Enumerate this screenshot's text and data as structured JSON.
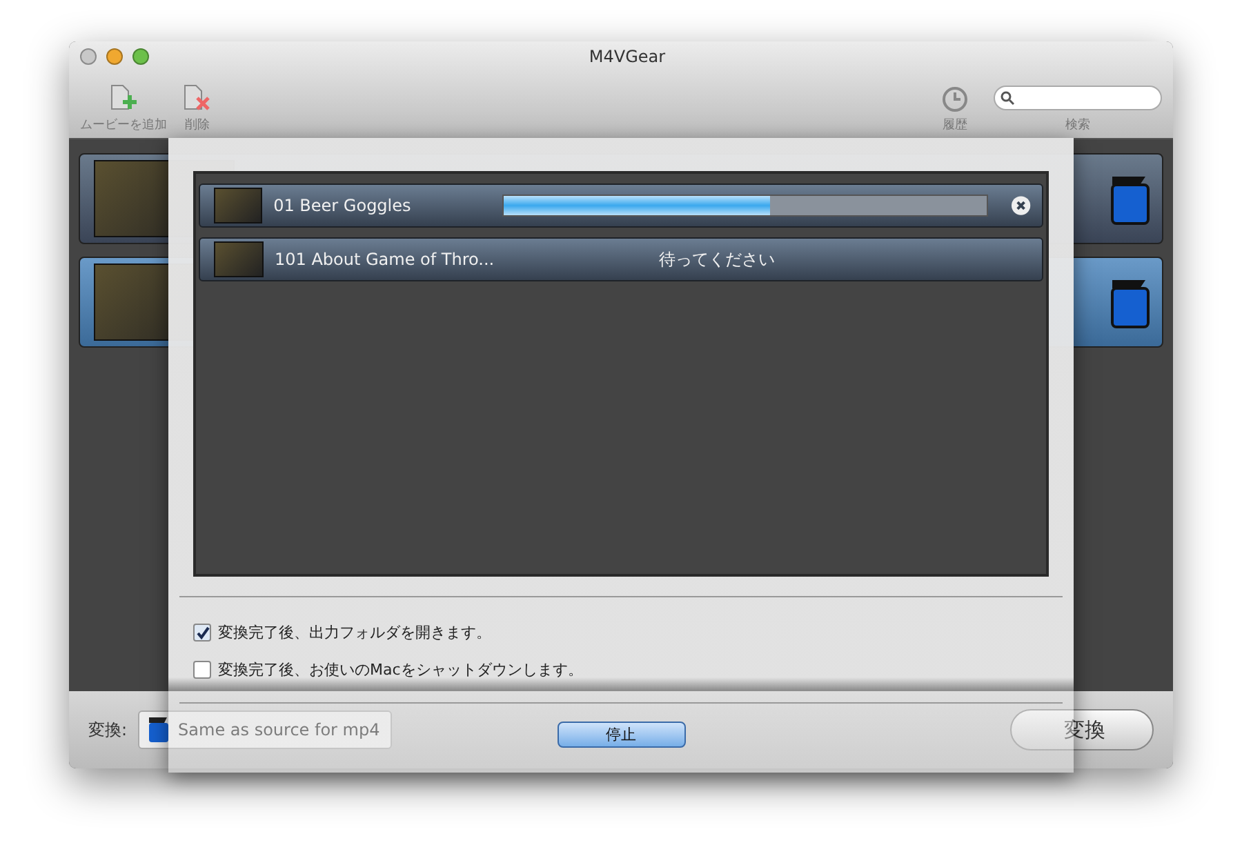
{
  "window": {
    "title": "M4VGear"
  },
  "toolbar": {
    "items": [
      {
        "label": "ムービーを追加",
        "kind": "add"
      },
      {
        "label": "削除",
        "kind": "delete"
      },
      {
        "label": "履歴",
        "kind": "history"
      }
    ],
    "search": {
      "label": "検索"
    }
  },
  "library": {
    "items": [
      {
        "selected": false
      },
      {
        "selected": true
      }
    ]
  },
  "bottom_bar": {
    "label": "変換:",
    "format": "Same as source for mp4",
    "convert_button": "変換"
  },
  "sheet": {
    "tasks": [
      {
        "title": "01 Beer Goggles",
        "kind": "progress",
        "level": 0.55
      },
      {
        "title": "101 About Game of Thro...",
        "kind": "waiting",
        "status": "待ってください"
      }
    ],
    "options": [
      {
        "label": "変換完了後、出力フォルダを開きます。",
        "checked": true
      },
      {
        "label": "変換完了後、お使いのMacをシャットダウンします。",
        "checked": false
      }
    ],
    "stop_button": "停止"
  }
}
